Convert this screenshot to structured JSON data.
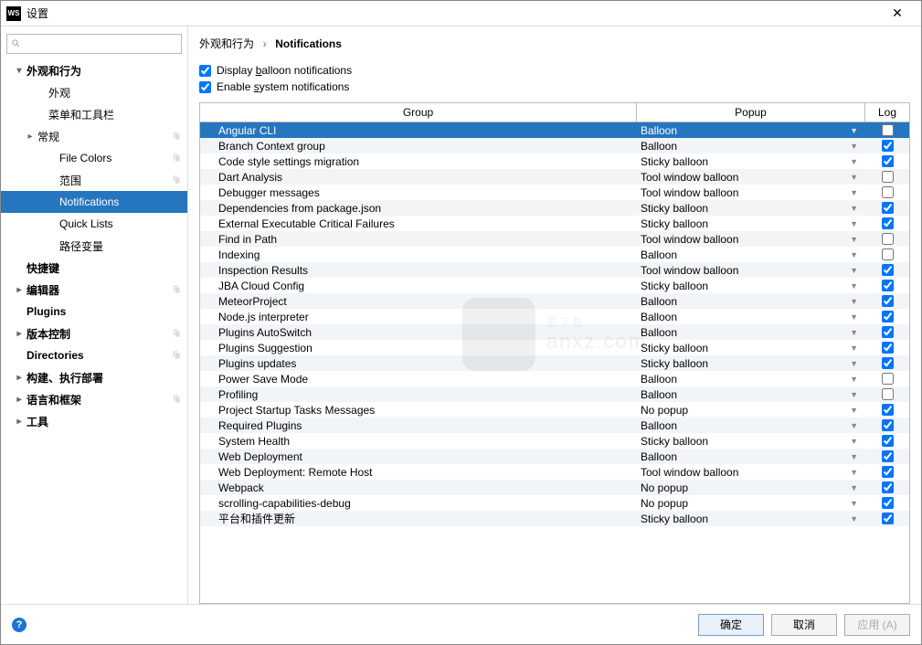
{
  "window": {
    "app_icon_label": "WS",
    "title": "设置"
  },
  "search": {
    "placeholder": ""
  },
  "sidebar": {
    "items": [
      {
        "id": "appearance-behavior",
        "label": "外观和行为",
        "level": 1,
        "expanded": true,
        "bold": true
      },
      {
        "id": "appearance",
        "label": "外观",
        "level": 2
      },
      {
        "id": "menus-toolbars",
        "label": "菜单和工具栏",
        "level": 2
      },
      {
        "id": "general",
        "label": "常规",
        "level": 2,
        "hasExpander": true,
        "badge": true
      },
      {
        "id": "file-colors",
        "label": "File Colors",
        "level": 3,
        "badge": true
      },
      {
        "id": "scopes",
        "label": "范围",
        "level": 3,
        "badge": true
      },
      {
        "id": "notifications",
        "label": "Notifications",
        "level": 3,
        "selected": true
      },
      {
        "id": "quick-lists",
        "label": "Quick Lists",
        "level": 3
      },
      {
        "id": "path-vars",
        "label": "路径变量",
        "level": 3
      },
      {
        "id": "keymap",
        "label": "快捷键",
        "level": 1,
        "bold": true,
        "noExpander": true
      },
      {
        "id": "editor",
        "label": "编辑器",
        "level": 1,
        "expanded": false,
        "bold": true,
        "badge": true
      },
      {
        "id": "plugins",
        "label": "Plugins",
        "level": 1,
        "bold": true,
        "noExpander": true
      },
      {
        "id": "vcs",
        "label": "版本控制",
        "level": 1,
        "expanded": false,
        "bold": true,
        "badge": true
      },
      {
        "id": "directories",
        "label": "Directories",
        "level": 1,
        "bold": true,
        "noExpander": true,
        "badge": true
      },
      {
        "id": "build-exec-deploy",
        "label": "构建、执行部署",
        "level": 1,
        "expanded": false,
        "bold": true
      },
      {
        "id": "lang-frameworks",
        "label": "语言和框架",
        "level": 1,
        "expanded": false,
        "bold": true,
        "badge": true
      },
      {
        "id": "tools",
        "label": "工具",
        "level": 1,
        "expanded": false,
        "bold": true
      }
    ]
  },
  "breadcrumb": {
    "parent": "外观和行为",
    "current": "Notifications",
    "sep": "›"
  },
  "checkboxes": {
    "display_balloon": {
      "checked": true,
      "pre": "Display ",
      "key": "b",
      "post": "alloon notifications"
    },
    "enable_system": {
      "checked": true,
      "pre": "Enable ",
      "key": "s",
      "post": "ystem notifications"
    }
  },
  "table": {
    "headers": {
      "group": "Group",
      "popup": "Popup",
      "log": "Log"
    },
    "rows": [
      {
        "group": "Angular CLI",
        "popup": "Balloon",
        "log": false,
        "selected": true
      },
      {
        "group": "Branch Context group",
        "popup": "Balloon",
        "log": true
      },
      {
        "group": "Code style settings migration",
        "popup": "Sticky balloon",
        "log": true
      },
      {
        "group": "Dart Analysis",
        "popup": "Tool window balloon",
        "log": false
      },
      {
        "group": "Debugger messages",
        "popup": "Tool window balloon",
        "log": false
      },
      {
        "group": "Dependencies from package.json",
        "popup": "Sticky balloon",
        "log": true
      },
      {
        "group": "External Executable Critical Failures",
        "popup": "Sticky balloon",
        "log": true
      },
      {
        "group": "Find in Path",
        "popup": "Tool window balloon",
        "log": false
      },
      {
        "group": "Indexing",
        "popup": "Balloon",
        "log": false
      },
      {
        "group": "Inspection Results",
        "popup": "Tool window balloon",
        "log": true
      },
      {
        "group": "JBA Cloud Config",
        "popup": "Sticky balloon",
        "log": true
      },
      {
        "group": "MeteorProject",
        "popup": "Balloon",
        "log": true
      },
      {
        "group": "Node.js interpreter",
        "popup": "Balloon",
        "log": true
      },
      {
        "group": "Plugins AutoSwitch",
        "popup": "Balloon",
        "log": true
      },
      {
        "group": "Plugins Suggestion",
        "popup": "Sticky balloon",
        "log": true
      },
      {
        "group": "Plugins updates",
        "popup": "Sticky balloon",
        "log": true
      },
      {
        "group": "Power Save Mode",
        "popup": "Balloon",
        "log": false
      },
      {
        "group": "Profiling",
        "popup": "Balloon",
        "log": false
      },
      {
        "group": "Project Startup Tasks Messages",
        "popup": "No popup",
        "log": true
      },
      {
        "group": "Required Plugins",
        "popup": "Balloon",
        "log": true
      },
      {
        "group": "System Health",
        "popup": "Sticky balloon",
        "log": true
      },
      {
        "group": "Web Deployment",
        "popup": "Balloon",
        "log": true
      },
      {
        "group": "Web Deployment: Remote Host",
        "popup": "Tool window balloon",
        "log": true
      },
      {
        "group": "Webpack",
        "popup": "No popup",
        "log": true
      },
      {
        "group": "scrolling-capabilities-debug",
        "popup": "No popup",
        "log": true
      },
      {
        "group": "平台和插件更新",
        "popup": "Sticky balloon",
        "log": true
      }
    ]
  },
  "footer": {
    "ok": "确定",
    "cancel": "取消",
    "apply": "应用 (A)"
  },
  "watermark": {
    "text": "安下载",
    "sub": "anxz.com"
  }
}
